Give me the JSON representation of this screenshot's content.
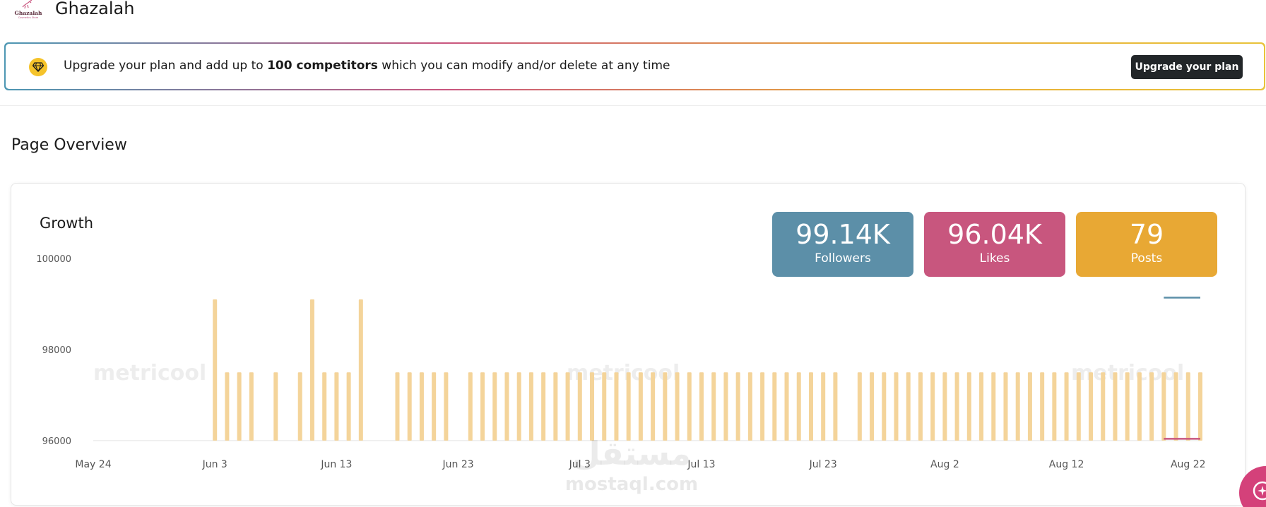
{
  "header": {
    "logo_text": "Ghazalah",
    "logo_subtext": "Cosmetics Store",
    "brand_name": "Ghazalah"
  },
  "banner": {
    "text_before": "Upgrade your plan and add up to ",
    "text_bold": "100 competitors",
    "text_after": " which you can modify and/or delete at any time",
    "button_label": "Upgrade your plan",
    "icon": "gem-icon"
  },
  "page": {
    "title": "Page Overview"
  },
  "growth": {
    "title": "Growth",
    "kpis": [
      {
        "value": "99.14K",
        "label": "Followers",
        "color": "#5c8fa8"
      },
      {
        "value": "96.04K",
        "label": "Likes",
        "color": "#c8567e"
      },
      {
        "value": "79",
        "label": "Posts",
        "color": "#e8a834"
      }
    ]
  },
  "watermark": {
    "brand": "metricool",
    "arabic": "مستقل",
    "site": "mostaql.com"
  },
  "fab": {
    "icon": "sparkle-icon"
  },
  "colors": {
    "bar": "#f4d49a",
    "followers_line": "#5c8fa8",
    "likes_line": "#c8567e",
    "banner_button": "#222629"
  },
  "chart_data": {
    "type": "bar",
    "ylim": [
      96000,
      100000
    ],
    "y_ticks": [
      "100000",
      "98000",
      "96000"
    ],
    "x_tick_labels": [
      "May 24",
      "Jun 3",
      "Jun 13",
      "Jun 23",
      "Jul 3",
      "Jul 13",
      "Jul 23",
      "Aug 2",
      "Aug 12",
      "Aug 22"
    ],
    "x_range": [
      "2024-05-24",
      "2024-08-23"
    ],
    "series": [
      {
        "type": "bar",
        "x": [
          "2024-06-03",
          "2024-06-04",
          "2024-06-05",
          "2024-06-06",
          "2024-06-08",
          "2024-06-10",
          "2024-06-11",
          "2024-06-12",
          "2024-06-13",
          "2024-06-14",
          "2024-06-15",
          "2024-06-18",
          "2024-06-19",
          "2024-06-20",
          "2024-06-21",
          "2024-06-22",
          "2024-06-24",
          "2024-06-25",
          "2024-06-26",
          "2024-06-27",
          "2024-06-28",
          "2024-06-29",
          "2024-06-30",
          "2024-07-01",
          "2024-07-02",
          "2024-07-03",
          "2024-07-04",
          "2024-07-05",
          "2024-07-06",
          "2024-07-07",
          "2024-07-08",
          "2024-07-09",
          "2024-07-10",
          "2024-07-11",
          "2024-07-12",
          "2024-07-13",
          "2024-07-14",
          "2024-07-15",
          "2024-07-16",
          "2024-07-17",
          "2024-07-18",
          "2024-07-19",
          "2024-07-20",
          "2024-07-21",
          "2024-07-22",
          "2024-07-23",
          "2024-07-24",
          "2024-07-26",
          "2024-07-27",
          "2024-07-28",
          "2024-07-29",
          "2024-07-30",
          "2024-07-31",
          "2024-08-01",
          "2024-08-02",
          "2024-08-03",
          "2024-08-04",
          "2024-08-05",
          "2024-08-06",
          "2024-08-07",
          "2024-08-08",
          "2024-08-09",
          "2024-08-10",
          "2024-08-11",
          "2024-08-12",
          "2024-08-13",
          "2024-08-14",
          "2024-08-15",
          "2024-08-16",
          "2024-08-17",
          "2024-08-18",
          "2024-08-19",
          "2024-08-20",
          "2024-08-21",
          "2024-08-22",
          "2024-08-23"
        ],
        "values": [
          99100,
          97500,
          97500,
          97500,
          97500,
          97500,
          99100,
          97500,
          97500,
          97500,
          99100,
          97500,
          97500,
          97500,
          97500,
          97500,
          97500,
          97500,
          97500,
          97500,
          97500,
          97500,
          97500,
          97500,
          97500,
          97500,
          97500,
          97500,
          97500,
          97500,
          97500,
          97500,
          97500,
          97500,
          97500,
          97500,
          97500,
          97500,
          97500,
          97500,
          97500,
          97500,
          97500,
          97500,
          97500,
          97500,
          97500,
          97500,
          97500,
          97500,
          97500,
          97500,
          97500,
          97500,
          97500,
          97500,
          97500,
          97500,
          97500,
          97500,
          97500,
          97500,
          97500,
          97500,
          97500,
          97500,
          97500,
          97500,
          97500,
          97500,
          97500,
          97500,
          97500,
          97500,
          97500,
          97500
        ]
      },
      {
        "type": "line",
        "x": [
          "2024-08-20",
          "2024-08-23"
        ],
        "values": [
          99140,
          99140
        ]
      },
      {
        "type": "line",
        "x": [
          "2024-08-20",
          "2024-08-23"
        ],
        "values": [
          96040,
          96040
        ]
      }
    ]
  }
}
